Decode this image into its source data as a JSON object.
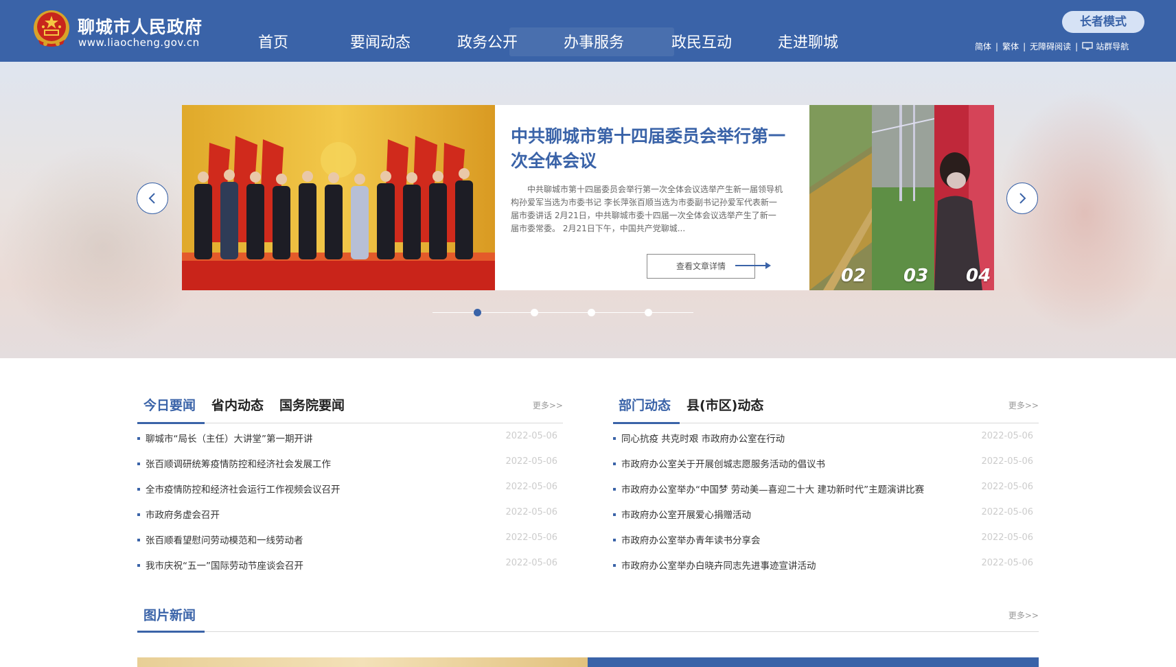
{
  "header": {
    "site_name": "聊城市人民政府",
    "site_url": "www.liaocheng.gov.cn",
    "nav": [
      "首页",
      "要闻动态",
      "政务公开",
      "办事服务",
      "政民互动",
      "走进聊城"
    ],
    "elder_mode": "长者模式",
    "util_links": [
      "简体",
      "繁体",
      "无障碍阅读",
      "站群导航"
    ],
    "colors": {
      "brand": "#3a63a8",
      "accent": "#d6e2f5"
    }
  },
  "banner": {
    "slide_title": "中共聊城市第十四届委员会举行第一次全体会议",
    "slide_summary": "中共聊城市第十四届委员会举行第一次全体会议选举产生新一届领导机构孙爱军当选为市委书记 李长萍张百顺当选为市委副书记孙爱军代表新一届市委讲话 2月21日，中共聊城市委十四届一次全体会议选举产生了新一届市委常委。 2月21日下午，中国共产党聊城...",
    "more_button": "查看文章详情",
    "thumbs": [
      "02",
      "03",
      "04"
    ],
    "active_dot": 1,
    "dot_count": 4
  },
  "left_section": {
    "tabs": [
      "今日要闻",
      "省内动态",
      "国务院要闻"
    ],
    "more": "更多>>",
    "items": [
      {
        "title": "聊城市“局长（主任）大讲堂”第一期开讲",
        "date": "2022-05-06"
      },
      {
        "title": "张百顺调研统筹疫情防控和经济社会发展工作",
        "date": "2022-05-06"
      },
      {
        "title": "全市疫情防控和经济社会运行工作视频会议召开",
        "date": "2022-05-06"
      },
      {
        "title": "市政府务虚会召开",
        "date": "2022-05-06"
      },
      {
        "title": "张百顺看望慰问劳动模范和一线劳动者",
        "date": "2022-05-06"
      },
      {
        "title": "我市庆祝“五一”国际劳动节座谈会召开",
        "date": "2022-05-06"
      }
    ]
  },
  "right_section": {
    "tabs": [
      "部门动态",
      "县(市区)动态"
    ],
    "more": "更多>>",
    "items": [
      {
        "title": "同心抗疫 共克时艰 市政府办公室在行动",
        "date": "2022-05-06"
      },
      {
        "title": "市政府办公室关于开展创城志愿服务活动的倡议书",
        "date": "2022-05-06"
      },
      {
        "title": "市政府办公室举办“中国梦 劳动美—喜迎二十大 建功新时代”主题演讲比赛",
        "date": "2022-05-06"
      },
      {
        "title": "市政府办公室开展爱心捐赠活动",
        "date": "2022-05-06"
      },
      {
        "title": "市政府办公室举办青年读书分享会",
        "date": "2022-05-06"
      },
      {
        "title": "市政府办公室举办白晓卉同志先进事迹宣讲活动",
        "date": "2022-05-06"
      }
    ]
  },
  "pic_section": {
    "title": "图片新闻",
    "more": "更多>>"
  }
}
